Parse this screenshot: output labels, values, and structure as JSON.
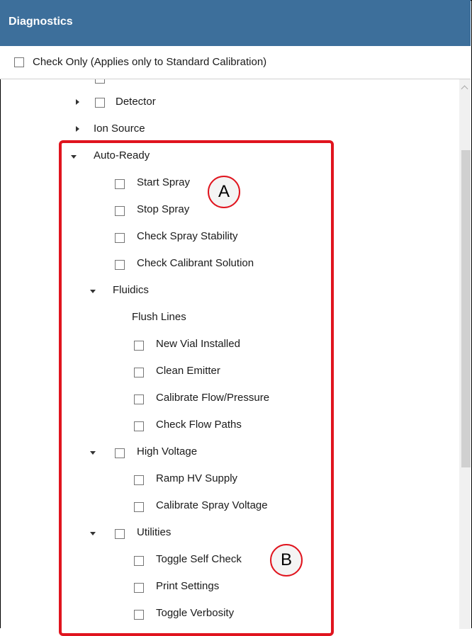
{
  "window": {
    "title": "Diagnostics"
  },
  "check_only": {
    "label": "Check Only (Applies only to Standard Calibration)",
    "checked": false
  },
  "tree": {
    "detector": "Detector",
    "ion_source": "Ion Source",
    "auto_ready": {
      "label": "Auto-Ready",
      "items": [
        "Start Spray",
        "Stop Spray",
        "Check Spray Stability",
        "Check Calibrant Solution"
      ],
      "fluidics": {
        "label": "Fluidics",
        "flush_lines": "Flush Lines",
        "items": [
          "New Vial Installed",
          "Clean Emitter",
          "Calibrate Flow/Pressure",
          "Check Flow Paths"
        ]
      },
      "high_voltage": {
        "label": "High Voltage",
        "items": [
          "Ramp HV Supply",
          "Calibrate Spray Voltage"
        ]
      },
      "utilities": {
        "label": "Utilities",
        "items": [
          "Toggle Self Check",
          "Print Settings",
          "Toggle Verbosity"
        ]
      }
    }
  },
  "callouts": {
    "a": "A",
    "b": "B"
  },
  "colors": {
    "titlebar": "#3d6f9b",
    "highlight": "#e0141e"
  }
}
